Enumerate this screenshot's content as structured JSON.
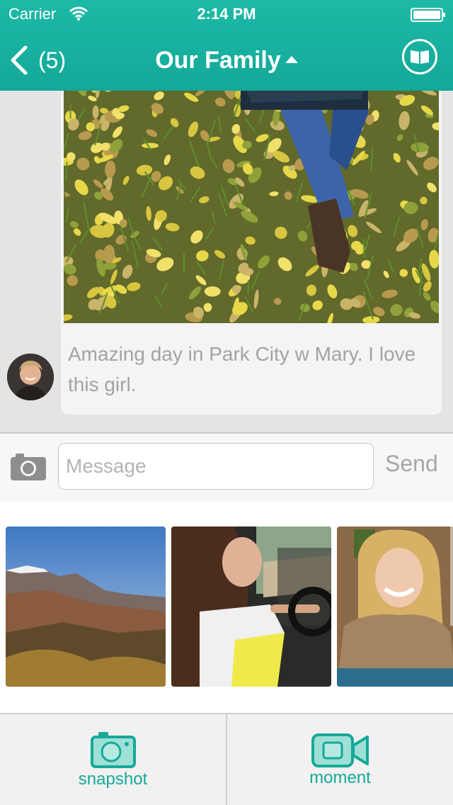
{
  "status_bar": {
    "carrier": "Carrier",
    "time": "2:14 PM"
  },
  "header": {
    "back_count": "(5)",
    "title": "Our Family",
    "accent_color": "#1cbaa6"
  },
  "post": {
    "caption": "Amazing day in Park City w Mary. I love this girl."
  },
  "composer": {
    "placeholder": "Message",
    "value": "",
    "send_label": "Send"
  },
  "tabs": [
    {
      "label": "snapshot",
      "icon": "camera-icon"
    },
    {
      "label": "moment",
      "icon": "video-camera-icon"
    }
  ]
}
